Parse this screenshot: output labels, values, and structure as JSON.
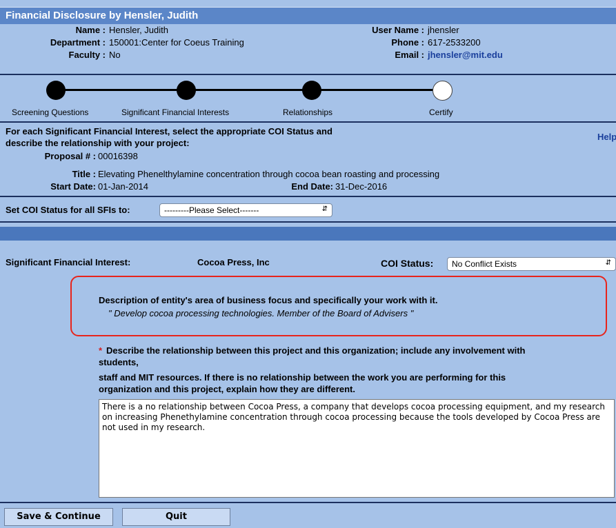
{
  "header": {
    "title": "Financial Disclosure by Hensler, Judith"
  },
  "person": {
    "name_label": "Name :",
    "name": "Hensler, Judith",
    "dept_label": "Department :",
    "department": "150001:Center for Coeus Training",
    "faculty_label": "Faculty :",
    "faculty": "No",
    "username_label": "User Name :",
    "username": "jhensler",
    "phone_label": "Phone :",
    "phone": "617-2533200",
    "email_label": "Email :",
    "email": "jhensler@mit.edu"
  },
  "steps": [
    {
      "label": "Screening Questions",
      "done": true
    },
    {
      "label": "Significant Financial Interests",
      "done": true
    },
    {
      "label": "Relationships",
      "done": true
    },
    {
      "label": "Certify",
      "done": false
    }
  ],
  "instructions": {
    "line1": "For each Significant Financial Interest, select the appropriate COI Status and",
    "line2": "describe the relationship with your project:",
    "help": "Help"
  },
  "proposal": {
    "number_label": "Proposal # :",
    "number": "00016398",
    "title_label": "Title :",
    "title": "Elevating Phenelthylamine concentration through cocoa bean roasting and processing",
    "start_label": "Start Date:",
    "start": "01-Jan-2014",
    "end_label": "End Date:",
    "end": "31-Dec-2016"
  },
  "set_all": {
    "label": "Set COI Status for all SFIs to:",
    "selected": "---------Please Select-------"
  },
  "sfi": {
    "label": "Significant Financial Interest:",
    "entity": "Cocoa Press, Inc",
    "status_label": "COI Status:",
    "status": "No Conflict Exists"
  },
  "entity_desc": {
    "heading": "Description of entity's area of business focus and specifically your work with it.",
    "text": "\" Develop cocoa processing technologies. Member of the Board of Advisers \""
  },
  "question": {
    "asterisk": "*",
    "line1": "Describe the relationship between this project and this organization; include any involvement with",
    "line2": "students,",
    "line3": "staff and MIT resources. If there is no relationship between the work you are performing for this",
    "line4": "organization and this project, explain how they are different."
  },
  "answer": "There is a no relationship between Cocoa Press, a company that develops cocoa processing equipment, and my research on increasing Phenethylamine concentration through cocoa processing because the tools developed by Cocoa Press are not used in my research.",
  "buttons": {
    "save": "Save & Continue",
    "quit": "Quit"
  }
}
